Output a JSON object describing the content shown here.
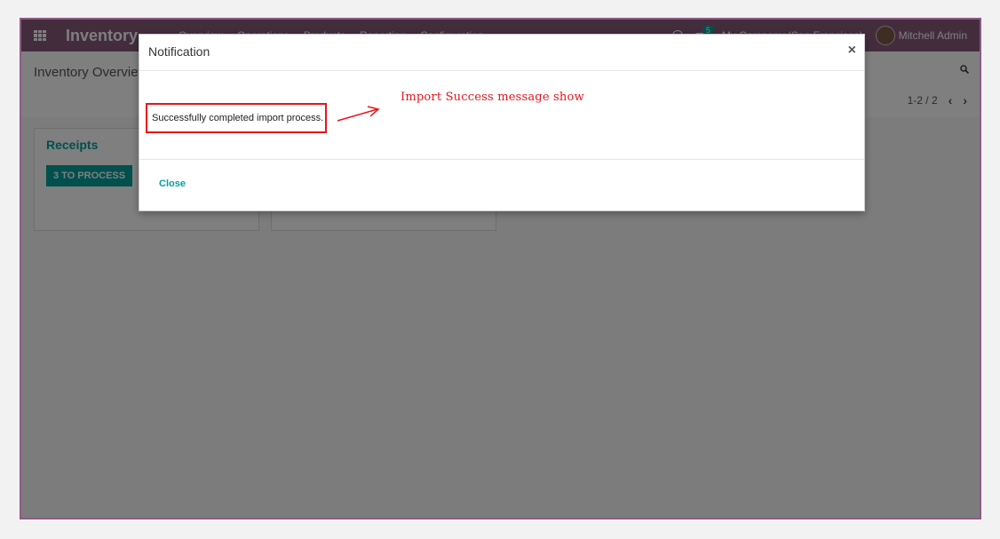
{
  "app": {
    "name": "Inventory"
  },
  "topnav": {
    "menus": [
      "Overview",
      "Operations",
      "Products",
      "Reporting",
      "Configuration"
    ],
    "chat_count": "5",
    "company": "My Company (San Francisco)",
    "user": "Mitchell Admin"
  },
  "control": {
    "breadcrumb": "Inventory Overview",
    "pager": "1-2 / 2"
  },
  "cards": [
    {
      "title": "Receipts",
      "button": "3 TO PROCESS"
    }
  ],
  "dialog": {
    "title": "Notification",
    "message": "Successfully completed import process.",
    "annotation": "Import  Success  message  show",
    "close_label": "Close",
    "close_x": "×"
  },
  "colors": {
    "nav": "#875a7b",
    "accent": "#00a09d",
    "annotation": "#e8141c"
  }
}
